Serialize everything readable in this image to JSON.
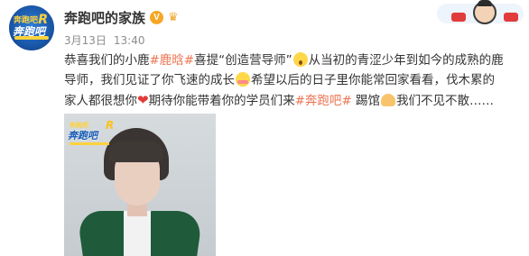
{
  "account": {
    "name": "奔跑吧的家族",
    "verified_badge": "V",
    "crown_icon": "crown-icon",
    "avatar_logo": {
      "top": "奔跑吧",
      "main": "奔跑吧",
      "mark": "R"
    }
  },
  "meta": {
    "date": "3月13日",
    "time": "13:40"
  },
  "post": {
    "line1": [
      {
        "type": "text",
        "value": "恭喜我们的小鹿"
      },
      {
        "type": "tag",
        "value": "#鹿晗#"
      },
      {
        "type": "text",
        "value": "喜提“创造营导师”"
      },
      {
        "type": "emoji",
        "value": "shock"
      },
      {
        "type": "text",
        "value": "从当初的青涩少年到如今的成熟的鹿"
      }
    ],
    "line2": [
      {
        "type": "text",
        "value": "导师，我们见证了你飞速的成长"
      },
      {
        "type": "emoji",
        "value": "blush"
      },
      {
        "type": "text",
        "value": "希望以后的日子里你能常回家看看，伐木累的"
      }
    ],
    "line3": [
      {
        "type": "text",
        "value": "家人都很想你"
      },
      {
        "type": "heart",
        "value": "❤"
      },
      {
        "type": "text",
        "value": "期待你能带着你的学员们来"
      },
      {
        "type": "tag",
        "value": "#奔跑吧#"
      },
      {
        "type": "text",
        "value": " 踢馆"
      },
      {
        "type": "hand",
        "value": ""
      },
      {
        "type": "text",
        "value": "我们不见不散……"
      }
    ]
  },
  "image": {
    "logo": {
      "top": "奔跑吧",
      "main": "奔跑吧",
      "mark": "R"
    }
  },
  "colors": {
    "tag": "#eb7350",
    "text": "#333333",
    "meta": "#8c8c8c",
    "badge": "#f6a623"
  }
}
